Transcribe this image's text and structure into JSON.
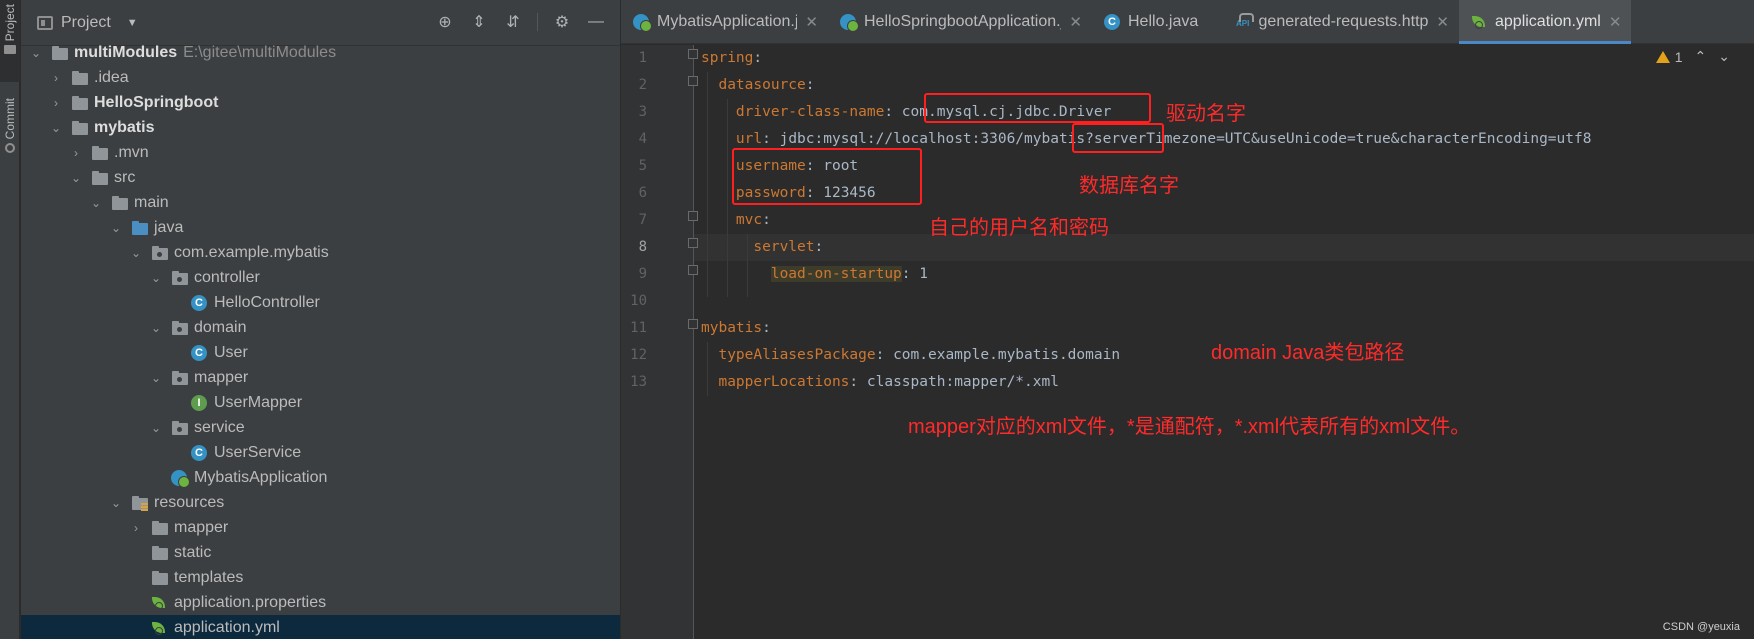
{
  "toolstrip": {
    "project_label": "Project",
    "commit_label": "Commit"
  },
  "project_panel": {
    "title": "Project",
    "tree": [
      {
        "label": "multiModules",
        "path": "E:\\gitee\\multiModules",
        "bold": true
      },
      {
        "label": ".idea"
      },
      {
        "label": "HelloSpringboot",
        "bold": true
      },
      {
        "label": "mybatis",
        "bold": true
      },
      {
        "label": ".mvn"
      },
      {
        "label": "src"
      },
      {
        "label": "main"
      },
      {
        "label": "java"
      },
      {
        "label": "com.example.mybatis"
      },
      {
        "label": "controller"
      },
      {
        "label": "HelloController"
      },
      {
        "label": "domain"
      },
      {
        "label": "User"
      },
      {
        "label": "mapper"
      },
      {
        "label": "UserMapper"
      },
      {
        "label": "service"
      },
      {
        "label": "UserService"
      },
      {
        "label": "MybatisApplication"
      },
      {
        "label": "resources"
      },
      {
        "label": "mapper"
      },
      {
        "label": "static"
      },
      {
        "label": "templates"
      },
      {
        "label": "application.properties"
      },
      {
        "label": "application.yml"
      }
    ]
  },
  "tabs": [
    {
      "label": "MybatisApplication.java"
    },
    {
      "label": "HelloSpringbootApplication.java"
    },
    {
      "label": "Hello.java"
    },
    {
      "label": "generated-requests.http"
    },
    {
      "label": "application.yml"
    }
  ],
  "editor": {
    "warning_count": "1",
    "line_numbers": [
      "1",
      "2",
      "3",
      "4",
      "5",
      "6",
      "7",
      "8",
      "9",
      "10",
      "11",
      "12",
      "13"
    ],
    "lines": {
      "l1_key": "spring",
      "l2_key": "datasource",
      "l3_key": "driver-class-name",
      "l3_val": "com.mysql.cj.jdbc.Driver",
      "l4_key": "url",
      "l4_val": "jdbc:mysql://localhost:3306/mybatis?serverTimezone=UTC&useUnicode=true&characterEncoding=utf8",
      "l5_key": "username",
      "l5_val": "root",
      "l6_key": "password",
      "l6_val": "123456",
      "l7_key": "mvc",
      "l8_key": "servlet",
      "l9_key": "load-on-startup",
      "l9_val": "1",
      "l11_key": "mybatis",
      "l12_key": "typeAliasesPackage",
      "l12_val": "com.example.mybatis.domain",
      "l13_key": "mapperLocations",
      "l13_val": "classpath:mapper/*.xml"
    }
  },
  "annotations": {
    "driver_name": "驱动名字",
    "db_name": "数据库名字",
    "user_pass": "自己的用户名和密码",
    "domain_path": "domain Java类包路径",
    "mapper_note": "mapper对应的xml文件，*是通配符，*.xml代表所有的xml文件。"
  },
  "watermark": "CSDN @yeuxia",
  "colors": {
    "keyword": "#cc7832",
    "value": "#a9b7c6",
    "annotation": "#ff2a2a",
    "accent": "#4a88c7"
  }
}
